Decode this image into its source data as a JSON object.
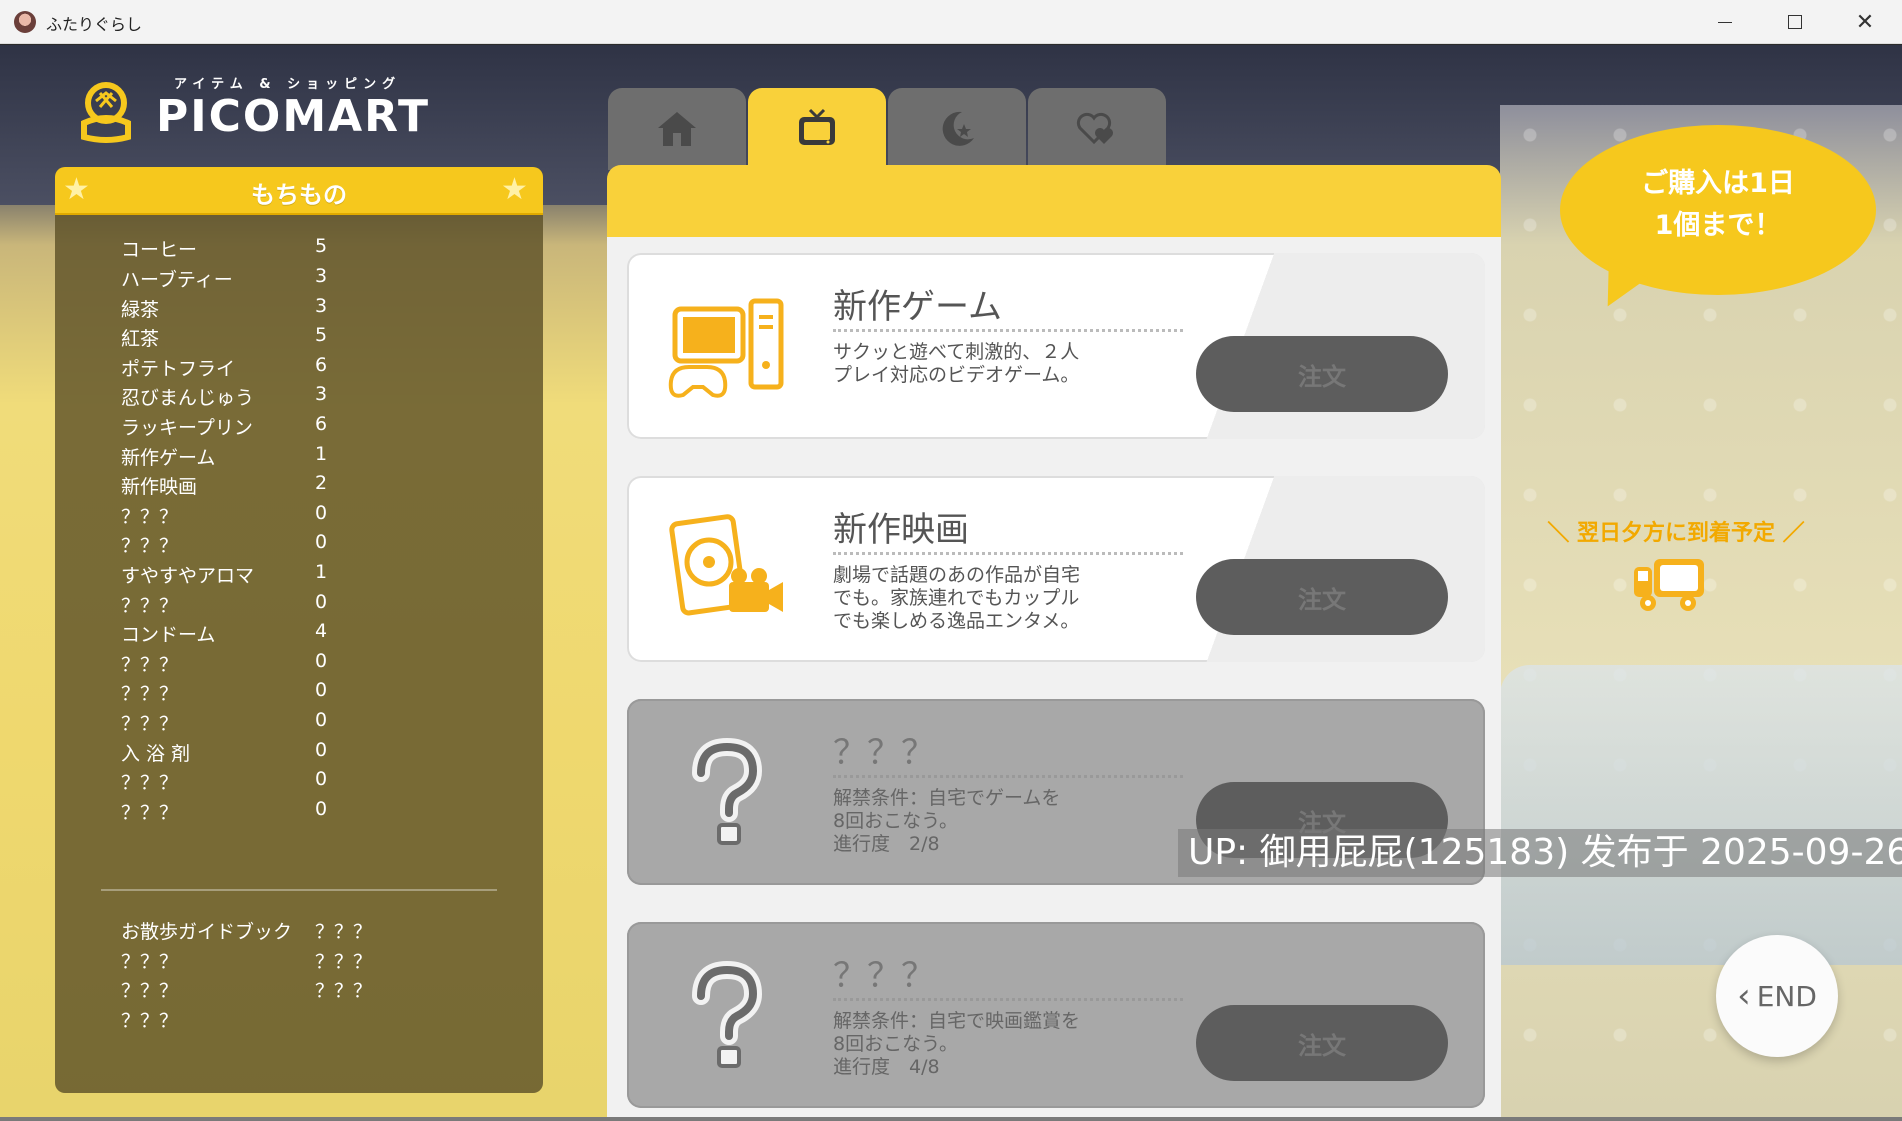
{
  "window": {
    "title": "ふたりぐらし"
  },
  "logo": {
    "subtitle": "アイテム & ショッピング",
    "name": "PICOMART"
  },
  "inventory": {
    "title": "もちもの",
    "items": [
      {
        "name": "コーヒー",
        "qty": "5"
      },
      {
        "name": "ハーブティー",
        "qty": "3"
      },
      {
        "name": "緑茶",
        "qty": "3"
      },
      {
        "name": "紅茶",
        "qty": "5"
      },
      {
        "name": "ポテトフライ",
        "qty": "6"
      },
      {
        "name": "忍びまんじゅう",
        "qty": "3"
      },
      {
        "name": "ラッキープリン",
        "qty": "6"
      },
      {
        "name": "新作ゲーム",
        "qty": "1"
      },
      {
        "name": "新作映画",
        "qty": "2"
      },
      {
        "name": "？？？",
        "qty": "0"
      },
      {
        "name": "？？？",
        "qty": "0"
      },
      {
        "name": "すやすやアロマ",
        "qty": "1"
      },
      {
        "name": "？？？",
        "qty": "0"
      },
      {
        "name": "コンドーム",
        "qty": "4"
      },
      {
        "name": "？？？",
        "qty": "0"
      },
      {
        "name": "？？？",
        "qty": "0"
      },
      {
        "name": "？？？",
        "qty": "0"
      },
      {
        "name": "入 浴 剤",
        "qty": "0"
      },
      {
        "name": "？？？",
        "qty": "0"
      },
      {
        "name": "？？？",
        "qty": "0"
      }
    ],
    "extras": [
      {
        "left": "お散歩ガイドブック",
        "right": "？？？"
      },
      {
        "left": "？？？",
        "right": "？？？"
      },
      {
        "left": "？？？",
        "right": "？？？"
      },
      {
        "left": "？？？",
        "right": ""
      }
    ]
  },
  "tabs": [
    {
      "icon": "home-icon",
      "active": false
    },
    {
      "icon": "tv-icon",
      "active": true
    },
    {
      "icon": "moon-star-icon",
      "active": false
    },
    {
      "icon": "heart-icon",
      "active": false
    }
  ],
  "products": [
    {
      "title": "新作ゲーム",
      "desc": [
        "サクッと遊べて刺激的、２人",
        "プレイ対応のビデオゲーム。"
      ],
      "button": "注文",
      "locked": false,
      "icon": "game-console-icon"
    },
    {
      "title": "新作映画",
      "desc": [
        "劇場で話題のあの作品が自宅",
        "でも。家族連れでもカップル",
        "でも楽しめる逸品エンタメ。"
      ],
      "button": "注文",
      "locked": false,
      "icon": "movie-disc-icon"
    },
    {
      "title": "？？？",
      "desc": [
        "解禁条件：自宅でゲームを",
        "8回おこなう。",
        "進行度　2/8"
      ],
      "button": "注文",
      "locked": true,
      "icon": "question-mark-icon"
    },
    {
      "title": "？？？",
      "desc": [
        "解禁条件：自宅で映画鑑賞を",
        "8回おこなう。",
        "進行度　4/8"
      ],
      "button": "注文",
      "locked": true,
      "icon": "question-mark-icon"
    }
  ],
  "notice": {
    "line1": "ご購入は1日",
    "line2": "1個まで！"
  },
  "delivery": {
    "text": "＼ 翌日夕方に到着予定 ／"
  },
  "end_button": {
    "label": "END"
  },
  "watermark": {
    "text": "UP: 御用屁屁(125183) 发布于 2025-09-26"
  },
  "colors": {
    "accent": "#f6c81d",
    "tab_inactive": "#6e6e6e",
    "button": "#5d5d5d",
    "delivery": "#f2a900"
  }
}
